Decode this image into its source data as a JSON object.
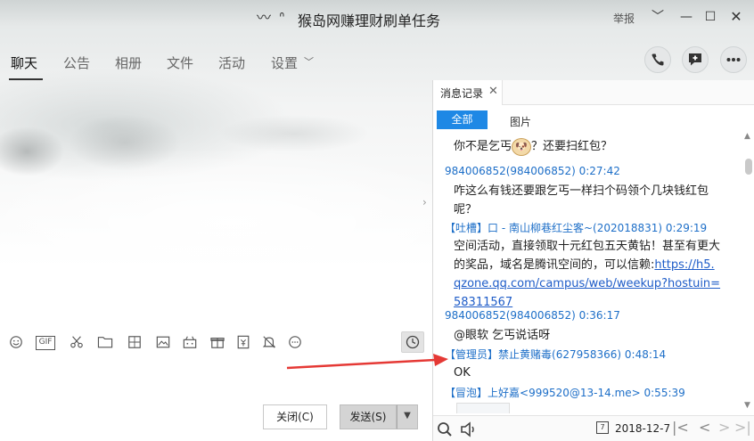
{
  "window": {
    "title": "猴岛网赚理财刷单任务",
    "report_label": "举报",
    "chevron": "﹀",
    "minimize": "—",
    "maximize": "☐",
    "close": "✕"
  },
  "tabs": [
    {
      "label": "聊天",
      "active": true
    },
    {
      "label": "公告"
    },
    {
      "label": "相册"
    },
    {
      "label": "文件"
    },
    {
      "label": "活动"
    },
    {
      "label": "设置"
    }
  ],
  "tab_dropdown": "﹀",
  "header_actions": [
    "phone-icon",
    "add-chat-icon",
    "more-icon"
  ],
  "right_panel": {
    "tab_label": "消息记录",
    "tab_close": "✕",
    "filter_all": "全部",
    "filter_images": "图片",
    "messages": [
      {
        "text_before": "你不是乞丐",
        "text_after": "？还要扫红包？"
      },
      {
        "sender": "984006852(984006852) 0:27:42",
        "text": "咋这么有钱还要跟乞丐一样扫个码领个几块钱红包呢？"
      },
      {
        "tag": "【吐槽】",
        "sender": "口 - 南山柳巷红尘客~(202018831) 0:29:19",
        "text": "空间活动，直接领取十元红包五天黄钻！甚至有更大的奖品，域名是腾讯空间的，可以信赖:",
        "link": "https://h5.qzone.qq.com/campus/web/weekup?hostuin=58311567"
      },
      {
        "sender": "984006852(984006852) 0:36:17",
        "text": "@眼软 乞丐说话呀"
      },
      {
        "tag": "【管理员】",
        "sender": "禁止黄赌毒(627958366) 0:48:14",
        "text": "OK"
      },
      {
        "tag": "【冒泡】",
        "sender": "上好嘉<999520@13-14.me> 0:55:39"
      }
    ],
    "date": "2018-12-7",
    "calendar_day": "7"
  },
  "buttons": {
    "close": "关闭(C)",
    "send": "发送(S)",
    "send_more": "▼"
  },
  "toolbar_icons": [
    "emoji-icon",
    "gif-icon",
    "scissors-icon",
    "folder-icon",
    "sticker-icon",
    "image-icon",
    "game-icon",
    "gift-icon",
    "coupon-icon",
    "bell-off-icon",
    "more-circle-icon"
  ],
  "colors": {
    "accent": "#1e88e5",
    "link": "#1e5cc8",
    "arrow": "#e53935"
  }
}
